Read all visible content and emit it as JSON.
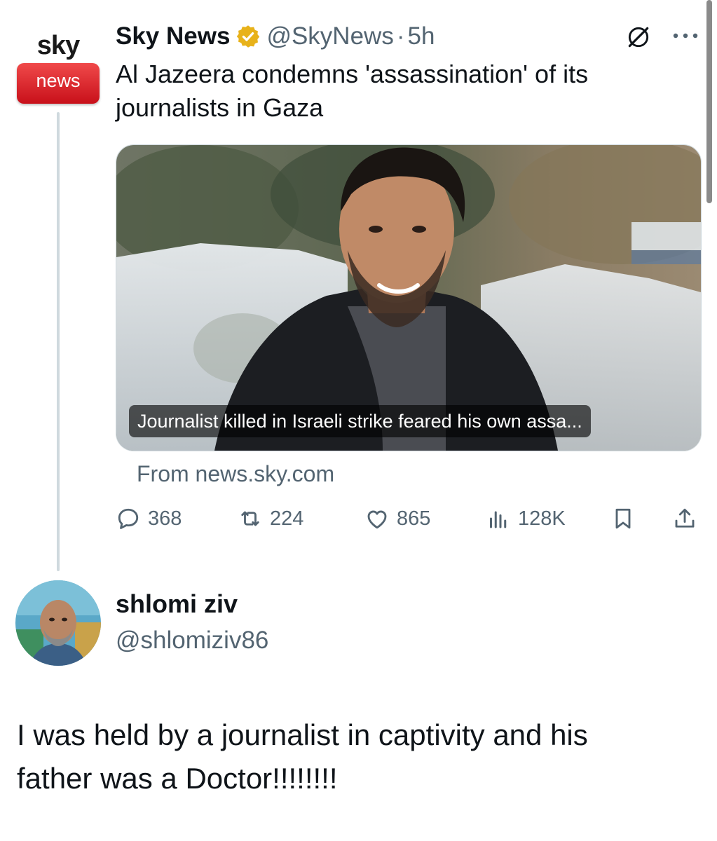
{
  "quoted_tweet": {
    "logo": {
      "top_text": "sky",
      "badge_text": "news"
    },
    "author_name": "Sky News",
    "verified_color": "#e8b21a",
    "handle": "@SkyNews",
    "separator": "·",
    "time": "5h",
    "text": "Al Jazeera condemns 'assassination' of its journalists in Gaza",
    "card": {
      "caption": "Journalist killed in Israeli strike feared his own assa...",
      "source": "From news.sky.com"
    },
    "stats": {
      "replies": "368",
      "retweets": "224",
      "likes": "865",
      "views": "128K"
    },
    "icons": [
      "grok-icon",
      "more-icon",
      "reply-icon",
      "retweet-icon",
      "like-icon",
      "views-icon",
      "bookmark-icon",
      "share-icon"
    ]
  },
  "reply": {
    "author_name": "shlomi ziv",
    "handle": "@shlomiziv86",
    "text_line1": "I was held by a journalist in captivity and his",
    "text_line2": "father was a Doctor!!!!!!!!"
  },
  "colors": {
    "primary_text": "#0f1419",
    "secondary_text": "#536471",
    "divider": "#cfd9de",
    "sky_red": "#d81e28"
  }
}
